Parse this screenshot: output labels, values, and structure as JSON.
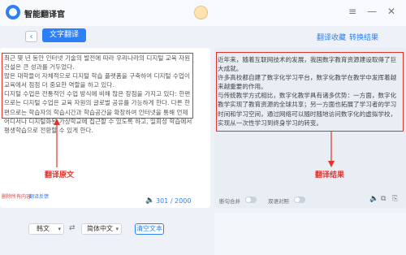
{
  "app": {
    "title": "智能翻译官"
  },
  "window": {
    "menu_icon": "≡",
    "minimize_icon": "—",
    "close_icon": "✕"
  },
  "nav": {
    "back_icon": "‹",
    "active_tab": "文字翻译",
    "favorites": "翻译收藏",
    "translation_result": "转换结果"
  },
  "source": {
    "paragraphs": [
      "최근 몇 년 동안 인터넷 기술의 발전에 따라 우리나라의 디지털 교육 자원 건설은 큰 성과를 거두었다.",
      "많은 대학들이 자체적으로 디지털 학습 플랫폼을 구축하여 디지털 수업이 교육에서 점점 더 중요한 역할을 하고 있다.",
      "디지털 수업은 전통적인 수업 방식에 비해 많은 장점을 가지고 있다: 한편으로는 디지털 수업은 교육 자원의 글로벌 공유를 가능하게 한다. 다른 한편으로는 학습자의 학습시간과 학습공간을 확장하여 인터넷을 통해 언제 어디서나 디지털화된 가상학교에 접근할 수 있도록 하고, 일회성 학습에서 평생학습으로 전환할 수 있게 한다."
    ],
    "clear_link": "删除所有内容",
    "feedback_link": "翻译反馈",
    "speaker_icon": "🔈",
    "char_count": "301 / 2000",
    "annotation": "翻译原文"
  },
  "target": {
    "paragraphs": [
      "近年来，随着互联网技术的发展，我国数字教育资源建设取得了巨大成就。",
      "许多高校都自建了数字化学习平台，数字化教学在教学中发挥着越来越重要的作用。",
      "与传统教学方式相比，数字化教学具有诸多优势：一方面，数字化教学实现了教育资源的全球共享；另一方面也拓展了学习者的学习时间和学习空间，通过网络可以随时随地访问数字化的虚拟学校，实现从一次性学习到终身学习的转变。"
    ],
    "toggle_auto_merge": "断句合并",
    "toggle_bilingual": "双语对照",
    "speaker_icon": "🔈",
    "copy_icon": "⧉",
    "export_icon": "⎘",
    "annotation": "翻译结果"
  },
  "footer": {
    "source_lang": "韩文",
    "target_lang": "简体中文",
    "swap_icon": "⇄",
    "chevron": "▾",
    "clear_button": "清空文本"
  },
  "colors": {
    "accent": "#2c7ff6",
    "annotation_red": "#e2322b"
  }
}
